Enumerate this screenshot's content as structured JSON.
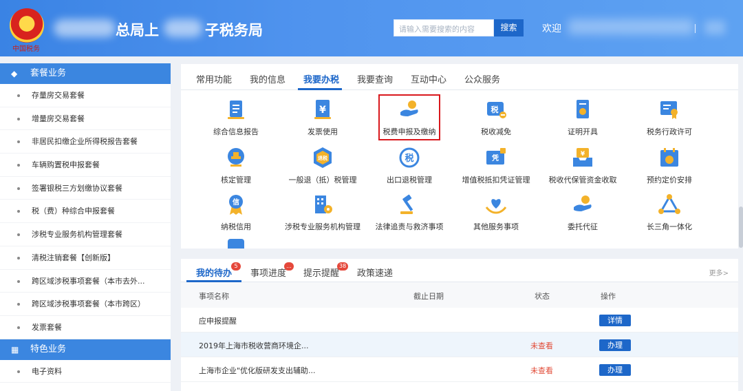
{
  "header": {
    "emblem_caption": "中国税务",
    "title_part1": "总局上",
    "title_part2": "子税务局",
    "search_placeholder": "请输入需要搜索的内容",
    "search_button": "搜索",
    "welcome": "欢迎"
  },
  "sidebar": {
    "section1": "套餐业务",
    "items": [
      "存量房交易套餐",
      "增量房交易套餐",
      "非居民扣缴企业所得税报告套餐",
      "车辆购置税申报套餐",
      "签署银税三方划缴协议套餐",
      "税（费）种综合申报套餐",
      "涉税专业服务机构管理套餐",
      "清税注销套餐【创新版】",
      "跨区域涉税事项套餐（本市去外...",
      "跨区域涉税事项套餐（本市跨区）",
      "发票套餐"
    ],
    "section2": "特色业务",
    "items2": [
      "电子资料"
    ]
  },
  "tabs": [
    "常用功能",
    "我的信息",
    "我要办税",
    "我要查询",
    "互动中心",
    "公众服务"
  ],
  "grid": [
    [
      "综合信息报告",
      "发票使用",
      "税费申报及缴纳",
      "税收减免",
      "证明开具",
      "税务行政许可"
    ],
    [
      "核定管理",
      "一般退（抵）税管理",
      "出口退税管理",
      "增值税抵扣凭证管理",
      "税收代保管资金收取",
      "预约定价安排"
    ],
    [
      "纳税信用",
      "涉税专业服务机构管理",
      "法律追责与救济事项",
      "其他服务事项",
      "委托代征",
      "长三角一体化"
    ]
  ],
  "icon_glyphs": {
    "ticket": "¥",
    "tax": "税",
    "cert": "凭",
    "credit": "信",
    "refund": "退税"
  },
  "todo": {
    "tabs": [
      "我的待办",
      "事项进度",
      "提示提醒",
      "政策速递"
    ],
    "badges": [
      "5",
      "...",
      "38"
    ],
    "more": "更多>",
    "columns": [
      "事项名称",
      "截止日期",
      "状态",
      "操作"
    ],
    "rows": [
      {
        "name": "应申报提醒",
        "status": "",
        "action": "详情"
      },
      {
        "name": "2019年上海市税收营商环境企...",
        "status": "未查看",
        "action": "办理"
      },
      {
        "name": "上海市企业\"优化版研发支出辅助...",
        "status": "未查看",
        "action": "办理"
      }
    ]
  }
}
